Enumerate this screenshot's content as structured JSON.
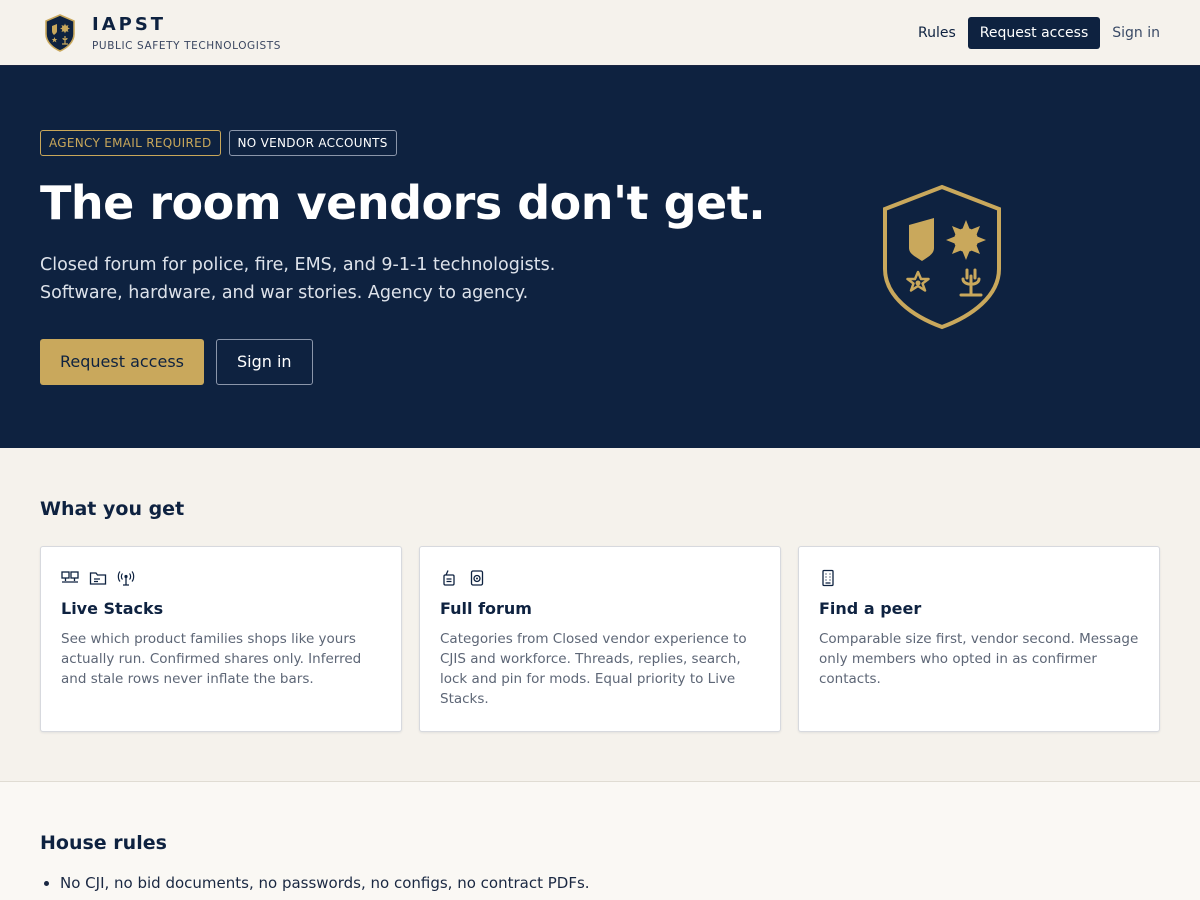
{
  "header": {
    "brand_name": "IAPST",
    "brand_subtitle": "PUBLIC SAFETY TECHNOLOGISTS",
    "nav": {
      "rules": "Rules",
      "request_access": "Request access",
      "sign_in": "Sign in"
    }
  },
  "hero": {
    "badges": [
      "AGENCY EMAIL REQUIRED",
      "NO VENDOR ACCOUNTS"
    ],
    "title": "The room vendors don't get.",
    "description": "Closed forum for police, fire, EMS, and 9-1-1 technologists. Software, hardware, and war stories. Agency to agency.",
    "primary_cta": "Request access",
    "secondary_cta": "Sign in"
  },
  "features": {
    "title": "What you get",
    "cards": [
      {
        "icons": [
          "monitors-icon",
          "folder-icon",
          "radio-tower-icon"
        ],
        "title": "Live Stacks",
        "body": "See which product families shops like yours actually run. Confirmed shares only. Inferred and stale rows never inflate the bars."
      },
      {
        "icons": [
          "radio-handset-icon",
          "speaker-icon"
        ],
        "title": "Full forum",
        "body": "Categories from Closed vendor experience to CJIS and workforce. Threads, replies, search, lock and pin for mods. Equal priority to Live Stacks."
      },
      {
        "icons": [
          "building-icon"
        ],
        "title": "Find a peer",
        "body": "Comparable size first, vendor second. Message only members who opted in as confirmer contacts."
      }
    ]
  },
  "rules": {
    "title": "House rules",
    "items": [
      "No CJI, no bid documents, no passwords, no configs, no contract PDFs."
    ]
  },
  "colors": {
    "navy": "#0e2240",
    "gold": "#c9a85c",
    "cream": "#f5f2ec"
  }
}
